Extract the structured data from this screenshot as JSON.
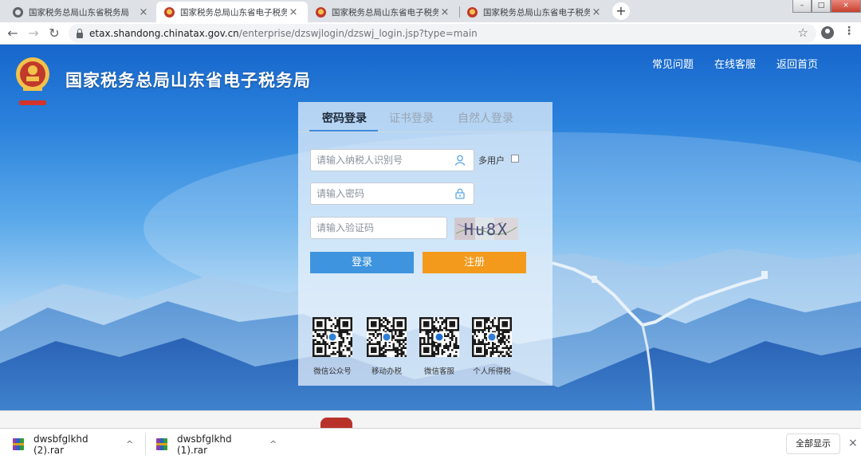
{
  "browser": {
    "tabs": [
      {
        "title": "国家税务总局山东省税务局",
        "icon": "globe-icon",
        "active": false
      },
      {
        "title": "国家税务总局山东省电子税务局",
        "icon": "tax-emblem-icon",
        "active": true
      },
      {
        "title": "国家税务总局山东省电子税务局",
        "icon": "tax-emblem-icon",
        "active": false
      },
      {
        "title": "国家税务总局山东省电子税务局",
        "icon": "tax-emblem-icon",
        "active": false
      }
    ],
    "tab_close_glyph": "×",
    "new_tab_glyph": "+",
    "window_controls": {
      "minimize": "–",
      "maximize": "□",
      "close": "×"
    },
    "nav": {
      "back": "←",
      "forward": "→",
      "reload": "↻"
    },
    "url": {
      "host": "etax.shandong.chinatax.gov.cn",
      "path": "/enterprise/dzswjlogin/dzswj_login.jsp?type=main"
    },
    "star_glyph": "☆",
    "menu_glyph": "⋮"
  },
  "site": {
    "title": "国家税务总局山东省电子税务局",
    "logo_icon": "tax-emblem-icon",
    "top_links": [
      "常见问题",
      "在线客服",
      "返回首页"
    ]
  },
  "login": {
    "tabs": [
      "密码登录",
      "证书登录",
      "自然人登录"
    ],
    "active_tab": 0,
    "taxpayer_id_placeholder": "请输入纳税人识别号",
    "password_placeholder": "请输入密码",
    "captcha_placeholder": "请输入验证码",
    "multi_user_label": "多用户",
    "captcha_text": "Hu8X",
    "login_button": "登录",
    "register_button": "注册",
    "qr_codes": [
      {
        "label": "微信公众号",
        "icon": "qr-code-icon"
      },
      {
        "label": "移动办税",
        "icon": "qr-code-icon"
      },
      {
        "label": "微信客服",
        "icon": "qr-code-icon"
      },
      {
        "label": "个人所得税",
        "icon": "qr-code-icon"
      }
    ]
  },
  "downloads": {
    "items": [
      {
        "name": "dwsbfglkhd (2).rar",
        "icon": "rar-archive-icon"
      },
      {
        "name": "dwsbfglkhd (1).rar",
        "icon": "rar-archive-icon"
      }
    ],
    "caret_glyph": "^",
    "show_all": "全部显示",
    "close_glyph": "×"
  },
  "colors": {
    "sky_top": "#1766cc",
    "login_button": "#3e94de",
    "register_button": "#f39a1c",
    "emblem_red": "#c0392b"
  }
}
